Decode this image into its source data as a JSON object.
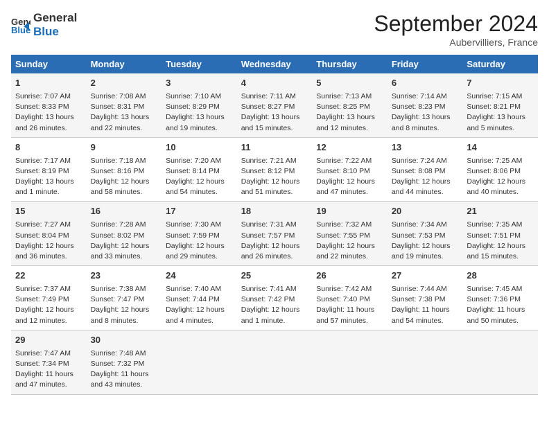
{
  "logo": {
    "line1": "General",
    "line2": "Blue"
  },
  "title": "September 2024",
  "location": "Aubervilliers, France",
  "days_header": [
    "Sunday",
    "Monday",
    "Tuesday",
    "Wednesday",
    "Thursday",
    "Friday",
    "Saturday"
  ],
  "weeks": [
    [
      {
        "num": "1",
        "lines": [
          "Sunrise: 7:07 AM",
          "Sunset: 8:33 PM",
          "Daylight: 13 hours",
          "and 26 minutes."
        ]
      },
      {
        "num": "2",
        "lines": [
          "Sunrise: 7:08 AM",
          "Sunset: 8:31 PM",
          "Daylight: 13 hours",
          "and 22 minutes."
        ]
      },
      {
        "num": "3",
        "lines": [
          "Sunrise: 7:10 AM",
          "Sunset: 8:29 PM",
          "Daylight: 13 hours",
          "and 19 minutes."
        ]
      },
      {
        "num": "4",
        "lines": [
          "Sunrise: 7:11 AM",
          "Sunset: 8:27 PM",
          "Daylight: 13 hours",
          "and 15 minutes."
        ]
      },
      {
        "num": "5",
        "lines": [
          "Sunrise: 7:13 AM",
          "Sunset: 8:25 PM",
          "Daylight: 13 hours",
          "and 12 minutes."
        ]
      },
      {
        "num": "6",
        "lines": [
          "Sunrise: 7:14 AM",
          "Sunset: 8:23 PM",
          "Daylight: 13 hours",
          "and 8 minutes."
        ]
      },
      {
        "num": "7",
        "lines": [
          "Sunrise: 7:15 AM",
          "Sunset: 8:21 PM",
          "Daylight: 13 hours",
          "and 5 minutes."
        ]
      }
    ],
    [
      {
        "num": "8",
        "lines": [
          "Sunrise: 7:17 AM",
          "Sunset: 8:19 PM",
          "Daylight: 13 hours",
          "and 1 minute."
        ]
      },
      {
        "num": "9",
        "lines": [
          "Sunrise: 7:18 AM",
          "Sunset: 8:16 PM",
          "Daylight: 12 hours",
          "and 58 minutes."
        ]
      },
      {
        "num": "10",
        "lines": [
          "Sunrise: 7:20 AM",
          "Sunset: 8:14 PM",
          "Daylight: 12 hours",
          "and 54 minutes."
        ]
      },
      {
        "num": "11",
        "lines": [
          "Sunrise: 7:21 AM",
          "Sunset: 8:12 PM",
          "Daylight: 12 hours",
          "and 51 minutes."
        ]
      },
      {
        "num": "12",
        "lines": [
          "Sunrise: 7:22 AM",
          "Sunset: 8:10 PM",
          "Daylight: 12 hours",
          "and 47 minutes."
        ]
      },
      {
        "num": "13",
        "lines": [
          "Sunrise: 7:24 AM",
          "Sunset: 8:08 PM",
          "Daylight: 12 hours",
          "and 44 minutes."
        ]
      },
      {
        "num": "14",
        "lines": [
          "Sunrise: 7:25 AM",
          "Sunset: 8:06 PM",
          "Daylight: 12 hours",
          "and 40 minutes."
        ]
      }
    ],
    [
      {
        "num": "15",
        "lines": [
          "Sunrise: 7:27 AM",
          "Sunset: 8:04 PM",
          "Daylight: 12 hours",
          "and 36 minutes."
        ]
      },
      {
        "num": "16",
        "lines": [
          "Sunrise: 7:28 AM",
          "Sunset: 8:02 PM",
          "Daylight: 12 hours",
          "and 33 minutes."
        ]
      },
      {
        "num": "17",
        "lines": [
          "Sunrise: 7:30 AM",
          "Sunset: 7:59 PM",
          "Daylight: 12 hours",
          "and 29 minutes."
        ]
      },
      {
        "num": "18",
        "lines": [
          "Sunrise: 7:31 AM",
          "Sunset: 7:57 PM",
          "Daylight: 12 hours",
          "and 26 minutes."
        ]
      },
      {
        "num": "19",
        "lines": [
          "Sunrise: 7:32 AM",
          "Sunset: 7:55 PM",
          "Daylight: 12 hours",
          "and 22 minutes."
        ]
      },
      {
        "num": "20",
        "lines": [
          "Sunrise: 7:34 AM",
          "Sunset: 7:53 PM",
          "Daylight: 12 hours",
          "and 19 minutes."
        ]
      },
      {
        "num": "21",
        "lines": [
          "Sunrise: 7:35 AM",
          "Sunset: 7:51 PM",
          "Daylight: 12 hours",
          "and 15 minutes."
        ]
      }
    ],
    [
      {
        "num": "22",
        "lines": [
          "Sunrise: 7:37 AM",
          "Sunset: 7:49 PM",
          "Daylight: 12 hours",
          "and 12 minutes."
        ]
      },
      {
        "num": "23",
        "lines": [
          "Sunrise: 7:38 AM",
          "Sunset: 7:47 PM",
          "Daylight: 12 hours",
          "and 8 minutes."
        ]
      },
      {
        "num": "24",
        "lines": [
          "Sunrise: 7:40 AM",
          "Sunset: 7:44 PM",
          "Daylight: 12 hours",
          "and 4 minutes."
        ]
      },
      {
        "num": "25",
        "lines": [
          "Sunrise: 7:41 AM",
          "Sunset: 7:42 PM",
          "Daylight: 12 hours",
          "and 1 minute."
        ]
      },
      {
        "num": "26",
        "lines": [
          "Sunrise: 7:42 AM",
          "Sunset: 7:40 PM",
          "Daylight: 11 hours",
          "and 57 minutes."
        ]
      },
      {
        "num": "27",
        "lines": [
          "Sunrise: 7:44 AM",
          "Sunset: 7:38 PM",
          "Daylight: 11 hours",
          "and 54 minutes."
        ]
      },
      {
        "num": "28",
        "lines": [
          "Sunrise: 7:45 AM",
          "Sunset: 7:36 PM",
          "Daylight: 11 hours",
          "and 50 minutes."
        ]
      }
    ],
    [
      {
        "num": "29",
        "lines": [
          "Sunrise: 7:47 AM",
          "Sunset: 7:34 PM",
          "Daylight: 11 hours",
          "and 47 minutes."
        ]
      },
      {
        "num": "30",
        "lines": [
          "Sunrise: 7:48 AM",
          "Sunset: 7:32 PM",
          "Daylight: 11 hours",
          "and 43 minutes."
        ]
      },
      {
        "num": "",
        "lines": []
      },
      {
        "num": "",
        "lines": []
      },
      {
        "num": "",
        "lines": []
      },
      {
        "num": "",
        "lines": []
      },
      {
        "num": "",
        "lines": []
      }
    ]
  ]
}
